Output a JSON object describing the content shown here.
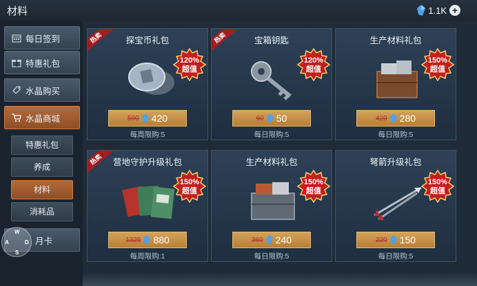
{
  "header": {
    "title": "材料",
    "currency_amount": "1.1K"
  },
  "sidebar": {
    "items": [
      {
        "label": "每日签到",
        "icon": "calendar-icon",
        "active": false
      },
      {
        "label": "特惠礼包",
        "icon": "gift-box-icon",
        "active": false
      },
      {
        "label": "水晶购买",
        "icon": "crystal-tag-icon",
        "active": false
      },
      {
        "label": "水晶商城",
        "icon": "cart-icon",
        "active": true
      },
      {
        "label": "月卡",
        "icon": "card-icon",
        "active": false
      }
    ],
    "subitems": [
      {
        "label": "特惠礼包",
        "active": false
      },
      {
        "label": "养成",
        "active": false
      },
      {
        "label": "材料",
        "active": true
      },
      {
        "label": "消耗品",
        "active": false
      }
    ]
  },
  "dpad": {
    "up": "W",
    "left": "A",
    "down": "S",
    "right": "D"
  },
  "cards": [
    {
      "name": "探宝币礼包",
      "hot": true,
      "hot_label": "热卖",
      "badge_pct": "120%",
      "badge_text": "超值",
      "old_price": "590",
      "price": "420",
      "limit": "每周限购:5",
      "art": "coin"
    },
    {
      "name": "宝箱钥匙",
      "hot": true,
      "hot_label": "热卖",
      "badge_pct": "120%",
      "badge_text": "超值",
      "old_price": "60",
      "price": "50",
      "limit": "每日限购:5",
      "art": "key"
    },
    {
      "name": "生产材料礼包",
      "hot": false,
      "hot_label": "",
      "badge_pct": "150%",
      "badge_text": "超值",
      "old_price": "420",
      "price": "280",
      "limit": "每日限购:5",
      "art": "crate"
    },
    {
      "name": "营地守护升级礼包",
      "hot": true,
      "hot_label": "热卖",
      "badge_pct": "150%",
      "badge_text": "超值",
      "old_price": "1325",
      "price": "880",
      "limit": "每周限购:1",
      "art": "books"
    },
    {
      "name": "生产材料礼包",
      "hot": false,
      "hot_label": "",
      "badge_pct": "150%",
      "badge_text": "超值",
      "old_price": "360",
      "price": "240",
      "limit": "每日限购:5",
      "art": "crate"
    },
    {
      "name": "弩箭升级礼包",
      "hot": false,
      "hot_label": "",
      "badge_pct": "150%",
      "badge_text": "超值",
      "old_price": "220",
      "price": "150",
      "limit": "每日限购:5",
      "art": "arrows"
    }
  ],
  "colors": {
    "accent": "#b56a38",
    "badge": "#c21f1f",
    "price_bar": "#c8924a",
    "hot": "#a11d22"
  }
}
